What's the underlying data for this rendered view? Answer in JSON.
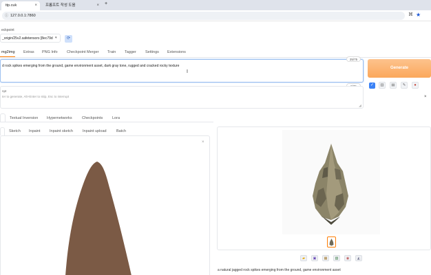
{
  "browser": {
    "tabs": [
      {
        "title": "ttp.cuk",
        "active": true
      },
      {
        "title": "프롬프트 작성 도움",
        "active": false
      }
    ],
    "new_tab": "+",
    "url": "127.0.0.1:7860"
  },
  "checkpoint": {
    "label": "eckpoint",
    "value": "_origin/25v2.safetensors [8ec79d"
  },
  "main_tabs": [
    "mg2img",
    "Extras",
    "PNG Info",
    "Checkpoint Merger",
    "Train",
    "Tagger",
    "Settings",
    "Extensions"
  ],
  "prompt": {
    "text": "d rock spikes emerging from the ground, game environment asset, dark gray tone, rugged and cracked rocky texture",
    "counter": "25/75"
  },
  "negative_prompt": {
    "label": "npt",
    "placeholder": "ter to generate, Alt+Enter to skip, Esc to interrupt",
    "counter": "0/75"
  },
  "generate_label": "Generate",
  "extra_tabs": [
    "Textual Inversion",
    "Hypernetworks",
    "Checkpoints",
    "Lora"
  ],
  "input_tabs": [
    "Sketch",
    "Inpaint",
    "Inpaint sketch",
    "Inpaint upload",
    "Batch"
  ],
  "output_caption": "a natural jagged rock spikes emerging from the ground, game environment asset",
  "colors": {
    "accent": "#fb923c",
    "generate_bg": "#fdba74",
    "rock_brown": "#7b5a45",
    "active_tab_border": "#ff7c00"
  },
  "icons": {
    "refresh": "refresh-icon",
    "close": "close-icon",
    "tools": [
      "folder-icon",
      "save-icon",
      "zip-icon",
      "image-send-icon",
      "palette-icon",
      "extras-icon"
    ]
  }
}
